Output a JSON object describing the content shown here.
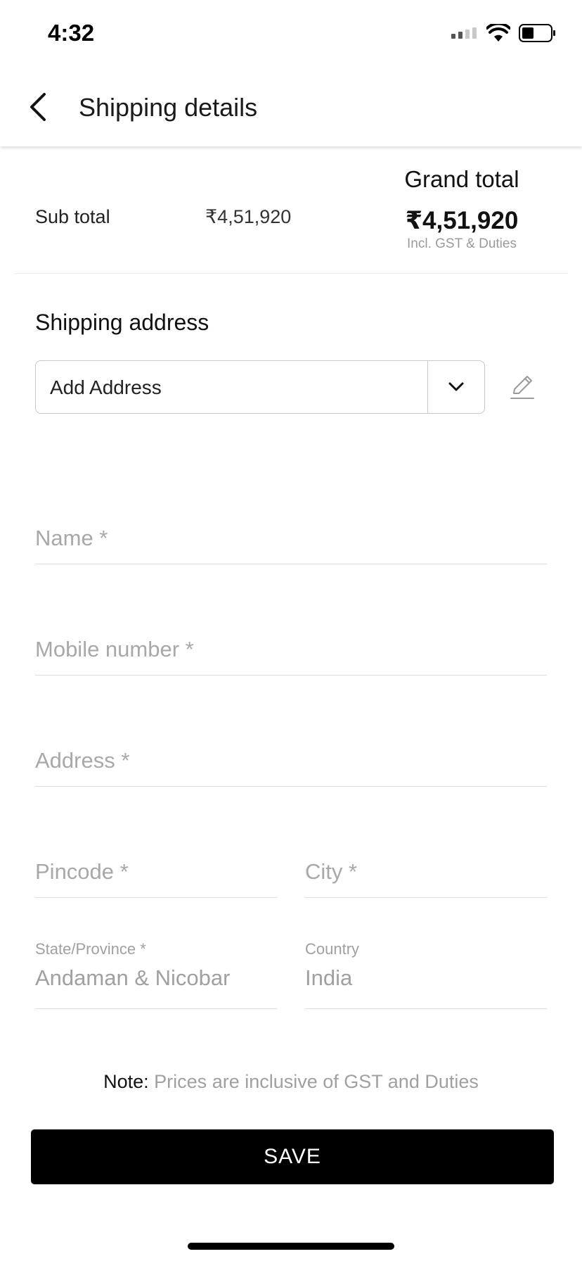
{
  "status_bar": {
    "time": "4:32"
  },
  "header": {
    "title": "Shipping details"
  },
  "totals": {
    "subtotal_label": "Sub total",
    "subtotal_value": "₹4,51,920",
    "grand_total_label": "Grand total",
    "grand_total_value": "₹4,51,920",
    "grand_total_note": "Incl. GST & Duties"
  },
  "shipping_address": {
    "title": "Shipping address",
    "select_value": "Add Address"
  },
  "form": {
    "name_placeholder": "Name *",
    "mobile_placeholder": "Mobile number *",
    "address_placeholder": "Address *",
    "pincode_placeholder": "Pincode *",
    "city_placeholder": "City *",
    "state_label": "State/Province *",
    "state_value": "Andaman & Nicobar",
    "country_label": "Country",
    "country_value": "India"
  },
  "note": {
    "label": "Note:",
    "text": "Prices are inclusive of GST and Duties"
  },
  "save_label": "SAVE",
  "colors": {
    "primary_button": "#000000",
    "placeholder": "#a0a0a0",
    "divider": "#dcdcdc"
  },
  "icons": [
    "signal-icon",
    "wifi-icon",
    "battery-icon",
    "back-arrow-icon",
    "chevron-down-icon",
    "pencil-icon"
  ]
}
